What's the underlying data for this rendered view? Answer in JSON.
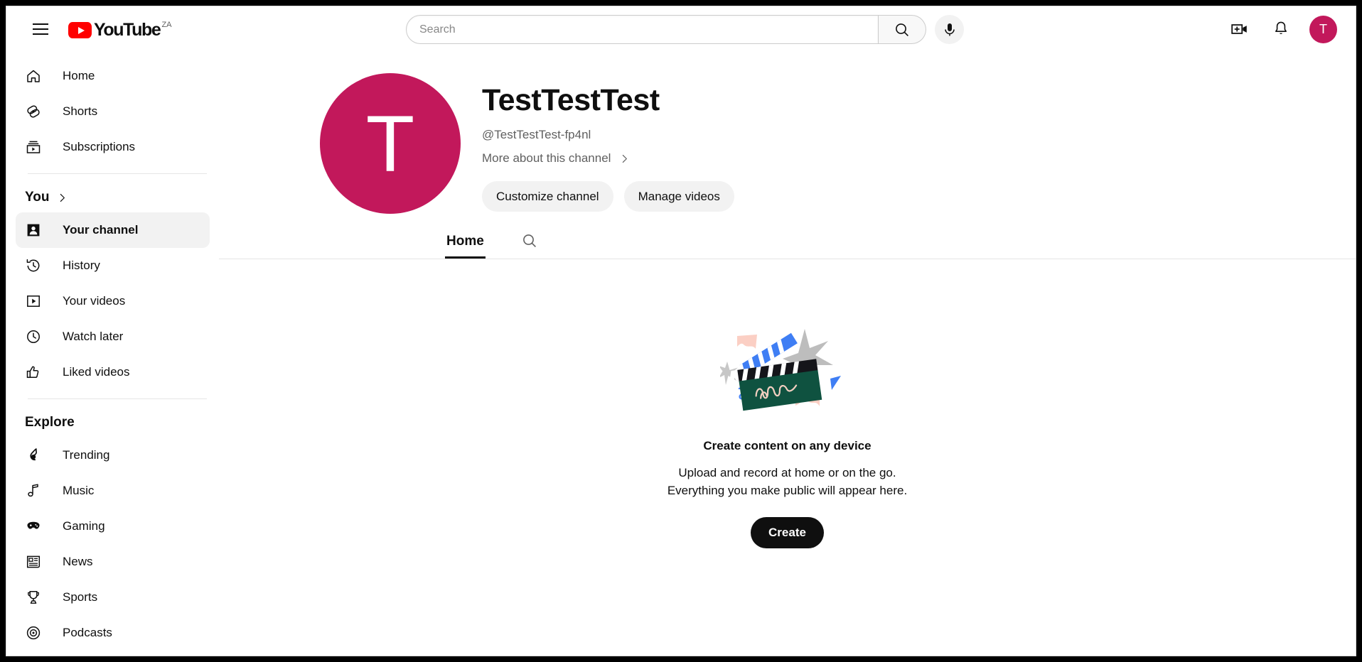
{
  "topbar": {
    "menu_icon": "hamburger-menu-icon",
    "logo_text": "YouTube",
    "logo_country": "ZA",
    "search": {
      "value": "",
      "placeholder": "Search",
      "button_icon": "search-icon"
    },
    "mic_icon": "microphone-icon",
    "create_video_icon": "create-video-icon",
    "notifications_icon": "bell-icon",
    "avatar_letter": "T",
    "avatar_color": "#C2185B"
  },
  "sidebar": {
    "primary": [
      {
        "label": "Home",
        "icon": "home-icon",
        "active": false
      },
      {
        "label": "Shorts",
        "icon": "shorts-icon",
        "active": false
      },
      {
        "label": "Subscriptions",
        "icon": "subscriptions-icon",
        "active": false
      }
    ],
    "you_section": {
      "title": "You",
      "chevron_icon": "chevron-right-icon"
    },
    "you_items": [
      {
        "label": "Your channel",
        "icon": "person-icon",
        "active": true
      },
      {
        "label": "History",
        "icon": "history-icon",
        "active": false
      },
      {
        "label": "Your videos",
        "icon": "video-play-icon",
        "active": false
      },
      {
        "label": "Watch later",
        "icon": "clock-icon",
        "active": false
      },
      {
        "label": "Liked videos",
        "icon": "thumbs-up-icon",
        "active": false
      }
    ],
    "explore_section": {
      "title": "Explore"
    },
    "explore_items": [
      {
        "label": "Trending",
        "icon": "trending-flame-icon",
        "active": false
      },
      {
        "label": "Music",
        "icon": "music-note-icon",
        "active": false
      },
      {
        "label": "Gaming",
        "icon": "gamepad-icon",
        "active": false
      },
      {
        "label": "News",
        "icon": "news-icon",
        "active": false
      },
      {
        "label": "Sports",
        "icon": "trophy-icon",
        "active": false
      },
      {
        "label": "Podcasts",
        "icon": "podcasts-icon",
        "active": false
      }
    ]
  },
  "channel": {
    "avatar_letter": "T",
    "avatar_color": "#C2185B",
    "name": "TestTestTest",
    "handle": "@TestTestTest-fp4nl",
    "more_link": "More about this channel",
    "more_chevron_icon": "chevron-right-icon",
    "actions": [
      {
        "label": "Customize channel"
      },
      {
        "label": "Manage videos"
      }
    ],
    "tabs": [
      {
        "label": "Home",
        "active": true
      }
    ],
    "tab_search_icon": "search-icon"
  },
  "empty_state": {
    "illustration": "clapperboard-illustration",
    "title": "Create content on any device",
    "line1": "Upload and record at home or on the go.",
    "line2": "Everything you make public will appear here.",
    "button_label": "Create"
  }
}
